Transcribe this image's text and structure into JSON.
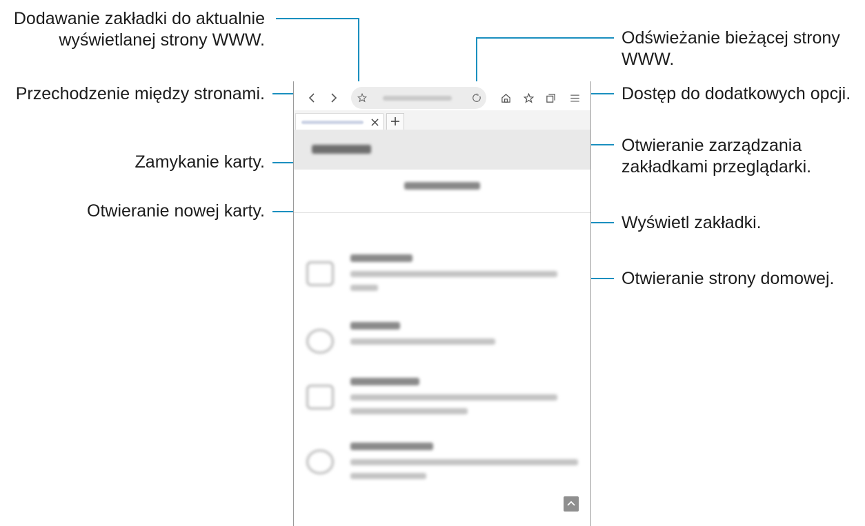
{
  "callouts": {
    "add_bookmark": [
      "Dodawanie zakładki do aktualnie",
      "wyświetlanej strony WWW."
    ],
    "navigate": "Przechodzenie między stronami.",
    "close_tab": "Zamykanie karty.",
    "new_tab": "Otwieranie nowej karty.",
    "refresh": [
      "Odświeżanie bieżącej strony",
      "WWW."
    ],
    "more_options": "Dostęp do dodatkowych opcji.",
    "tab_manager": [
      "Otwieranie zarządzania",
      "zakładkami przeglądarki."
    ],
    "view_bookmarks": "Wyświetl zakładki.",
    "home_page": "Otwieranie strony domowej."
  },
  "colors": {
    "accent_line": "#1a8fbf"
  },
  "icons": [
    "back-icon",
    "forward-icon",
    "bookmark-star-icon",
    "refresh-icon",
    "home-icon",
    "bookmarks-icon",
    "tabs-icon",
    "menu-icon",
    "close-icon",
    "plus-icon",
    "scroll-top-icon"
  ]
}
